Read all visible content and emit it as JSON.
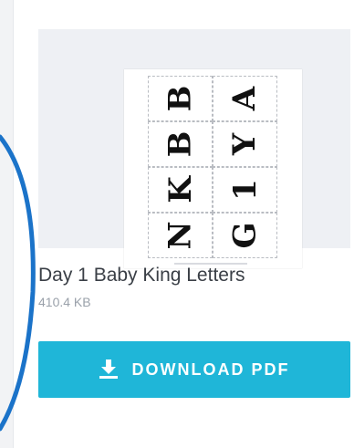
{
  "item": {
    "title": "Day 1 Baby King Letters",
    "file_size": "410.4 KB",
    "download_label": "DOWNLOAD PDF",
    "download_icon": "download-icon"
  },
  "thumbnail": {
    "letters_left": [
      "B",
      "B",
      "K",
      "N"
    ],
    "letters_right": [
      "A",
      "Y",
      "1",
      "G"
    ]
  },
  "colors": {
    "accent": "#1fb6d8",
    "annotation_circle": "#1b73c9"
  }
}
